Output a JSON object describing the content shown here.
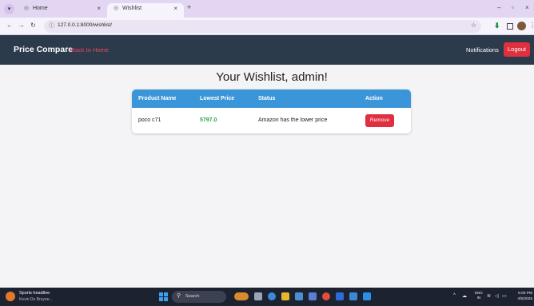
{
  "browser": {
    "tabs": [
      {
        "label": "Home",
        "close": "×"
      },
      {
        "label": "Wishlist",
        "close": "×"
      }
    ],
    "new_tab": "+",
    "url": "127.0.0.1:8000/wishlist/"
  },
  "navbar": {
    "brand": "Price Compare",
    "back_link": "Back to Home",
    "notifications": "Notifications",
    "logout": "Logout"
  },
  "page": {
    "heading": "Your Wishlist, admin!"
  },
  "wishlist_table": {
    "headers": [
      "Product Name",
      "Lowest Price",
      "Status",
      "Action"
    ],
    "rows": [
      {
        "product": "poco c71",
        "price": "5797.0",
        "status": "Amazon has the lower price",
        "action": "Remove"
      }
    ]
  },
  "taskbar": {
    "news_title": "Sports headline",
    "news_sub": "Kevin De Bruyne...",
    "search": "Search",
    "lang_1": "ENG",
    "lang_2": "IN",
    "time": "5:00 PM",
    "date": "4/5/2025"
  },
  "colors": {
    "navbar": "#2b3b4c",
    "accent_red": "#e0303f",
    "table_header": "#3a96d9",
    "price_green": "#2aa84a"
  }
}
